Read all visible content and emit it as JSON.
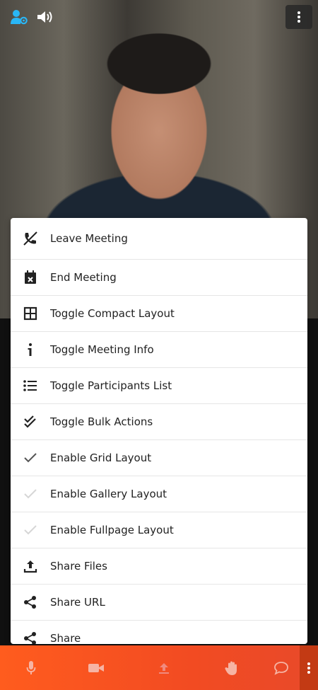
{
  "menu": {
    "items": [
      {
        "label": "Leave Meeting",
        "icon": "leave-meeting-icon"
      },
      {
        "label": "End Meeting",
        "icon": "end-meeting-icon"
      },
      {
        "label": "Toggle Compact Layout",
        "icon": "compact-layout-icon"
      },
      {
        "label": "Toggle Meeting Info",
        "icon": "info-icon"
      },
      {
        "label": "Toggle Participants List",
        "icon": "list-icon"
      },
      {
        "label": "Toggle Bulk Actions",
        "icon": "double-check-icon"
      },
      {
        "label": "Enable Grid Layout",
        "icon": "check-icon",
        "checked": true
      },
      {
        "label": "Enable Gallery Layout",
        "icon": "check-icon",
        "checked": false
      },
      {
        "label": "Enable Fullpage Layout",
        "icon": "check-icon",
        "checked": false
      },
      {
        "label": "Share Files",
        "icon": "upload-icon"
      },
      {
        "label": "Share URL",
        "icon": "share-icon"
      },
      {
        "label": "Share",
        "icon": "share-icon"
      }
    ]
  },
  "toolbar": {
    "buttons": [
      "microphone-icon",
      "camera-icon",
      "screen-share-icon",
      "raise-hand-icon",
      "chat-icon",
      "more-options-icon"
    ]
  },
  "colors": {
    "accent": "#29b6f6",
    "toolbar": "#f24b22",
    "toolbar_more": "#c33a14",
    "menu_text": "#222222"
  }
}
